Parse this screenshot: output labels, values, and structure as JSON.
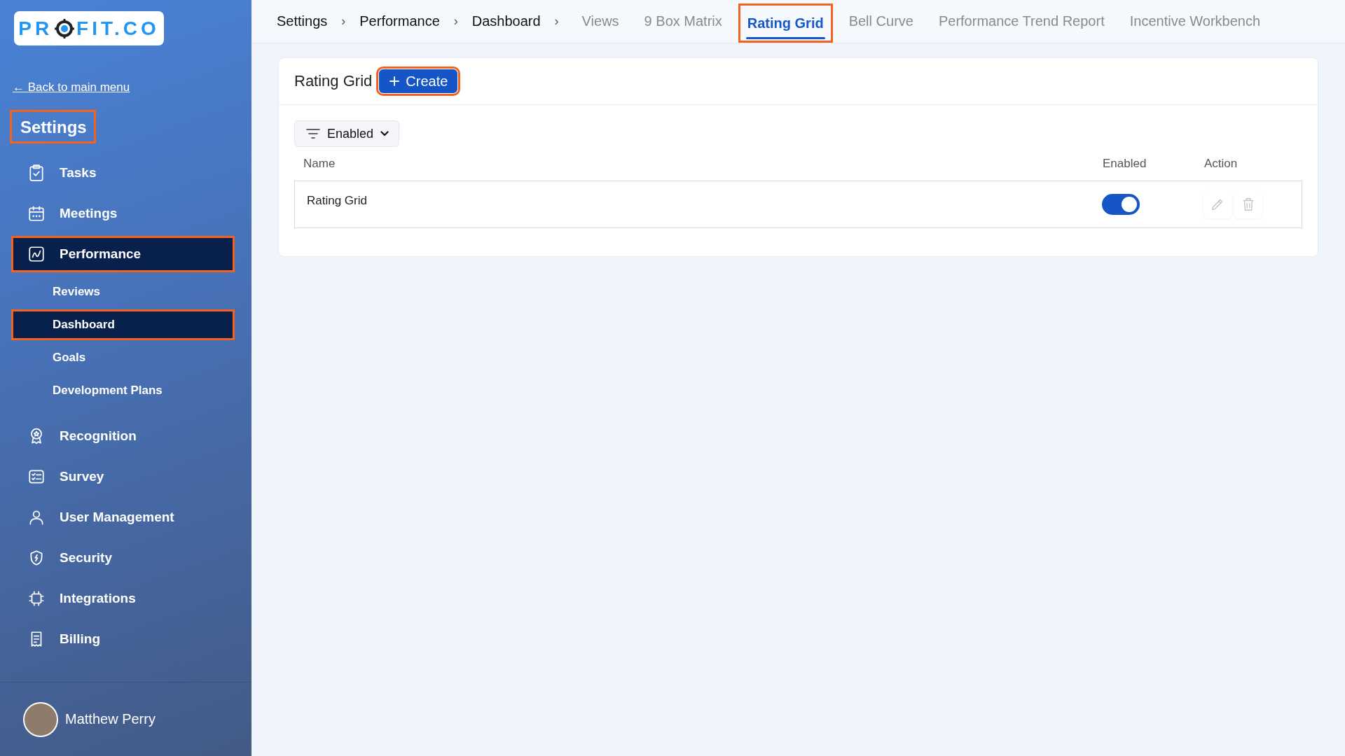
{
  "logo": {
    "before": "PR",
    "after": "FIT.CO"
  },
  "sidebar": {
    "back_link": "← Back to main menu",
    "title": {
      "text": "Settings",
      "highlighted": true
    },
    "items": [
      {
        "label": "Tasks",
        "kind": "tasks",
        "selected": false,
        "highlighted": false
      },
      {
        "label": "Meetings",
        "kind": "calendar",
        "selected": false,
        "highlighted": false
      },
      {
        "label": "Performance",
        "kind": "chart",
        "selected": true,
        "highlighted": true,
        "children": [
          {
            "label": "Reviews",
            "selected": false,
            "highlighted": false
          },
          {
            "label": "Dashboard",
            "selected": true,
            "highlighted": true
          },
          {
            "label": "Goals",
            "selected": false,
            "highlighted": false
          },
          {
            "label": "Development Plans",
            "selected": false,
            "highlighted": false
          }
        ]
      },
      {
        "label": "Recognition",
        "kind": "badge",
        "selected": false,
        "highlighted": false
      },
      {
        "label": "Survey",
        "kind": "checklist",
        "selected": false,
        "highlighted": false
      },
      {
        "label": "User Management",
        "kind": "user",
        "selected": false,
        "highlighted": false
      },
      {
        "label": "Security",
        "kind": "shield",
        "selected": false,
        "highlighted": false
      },
      {
        "label": "Integrations",
        "kind": "chip",
        "selected": false,
        "highlighted": false
      },
      {
        "label": "Billing",
        "kind": "receipt",
        "selected": false,
        "highlighted": false
      }
    ],
    "user": {
      "name": "Matthew Perry"
    }
  },
  "breadcrumb": [
    "Settings",
    "Performance",
    "Dashboard"
  ],
  "breadcrumb_separator": "›",
  "tabs": [
    {
      "label": "Views",
      "selected": false,
      "highlighted": false
    },
    {
      "label": "9 Box Matrix",
      "selected": false,
      "highlighted": false
    },
    {
      "label": "Rating Grid",
      "selected": true,
      "highlighted": true
    },
    {
      "label": "Bell Curve",
      "selected": false,
      "highlighted": false
    },
    {
      "label": "Performance Trend Report",
      "selected": false,
      "highlighted": false
    },
    {
      "label": "Incentive Workbench",
      "selected": false,
      "highlighted": false
    }
  ],
  "card": {
    "title": "Rating Grid",
    "create_button": {
      "label": "Create",
      "highlighted": true
    },
    "filter": {
      "label": "Enabled"
    },
    "table": {
      "columns": [
        "Name",
        "Enabled",
        "Action"
      ],
      "rows": [
        {
          "name": "Rating Grid",
          "enabled": true
        }
      ]
    }
  }
}
